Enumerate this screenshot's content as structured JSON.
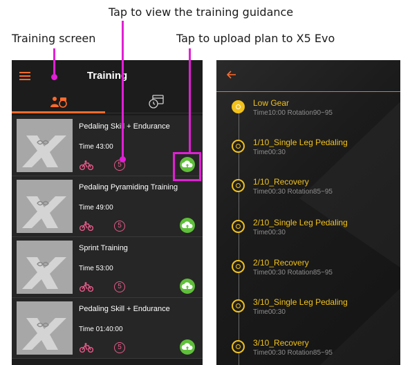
{
  "annotations": {
    "guidance": "Tap to view the training guidance",
    "training_screen": "Training screen",
    "upload": "Tap to upload plan to X5 Evo"
  },
  "left_screen": {
    "title": "Training",
    "tabs": [
      {
        "icon": "person-bike-icon",
        "active": true
      },
      {
        "icon": "calendar-clock-icon",
        "active": false
      }
    ],
    "cards": [
      {
        "title": "Pedaling Skill + Endurance",
        "time": "Time  43:00",
        "count": "5"
      },
      {
        "title": "Pedaling Pyramiding Training",
        "time": "Time  49:00",
        "count": "5"
      },
      {
        "title": "Sprint Training",
        "time": "Time  53:00",
        "count": "5"
      },
      {
        "title": "Pedaling Skill + Endurance",
        "time": "Time  01:40:00",
        "count": "5"
      }
    ]
  },
  "right_screen": {
    "steps": [
      {
        "title": "Low Gear",
        "meta": "Time10:00  Rotation90~95",
        "active": true
      },
      {
        "title": "1/10_Single Leg Pedaling",
        "meta": "Time00:30",
        "active": false
      },
      {
        "title": "1/10_Recovery",
        "meta": "Time00:30  Rotation85~95",
        "active": false
      },
      {
        "title": "2/10_Single Leg Pedaling",
        "meta": "Time00:30",
        "active": false
      },
      {
        "title": "2/10_Recovery",
        "meta": "Time00:30  Rotation85~95",
        "active": false
      },
      {
        "title": "3/10_Single Leg Pedaling",
        "meta": "Time00:30",
        "active": false
      },
      {
        "title": "3/10_Recovery",
        "meta": "Time00:30  Rotation85~95",
        "active": false
      }
    ]
  },
  "colors": {
    "accent": "#ff6a2b",
    "annotation": "#e21fd6",
    "step_yellow": "#f2c21b",
    "upload_green": "#5fbf3a",
    "badge_pink": "#e85a8a"
  }
}
